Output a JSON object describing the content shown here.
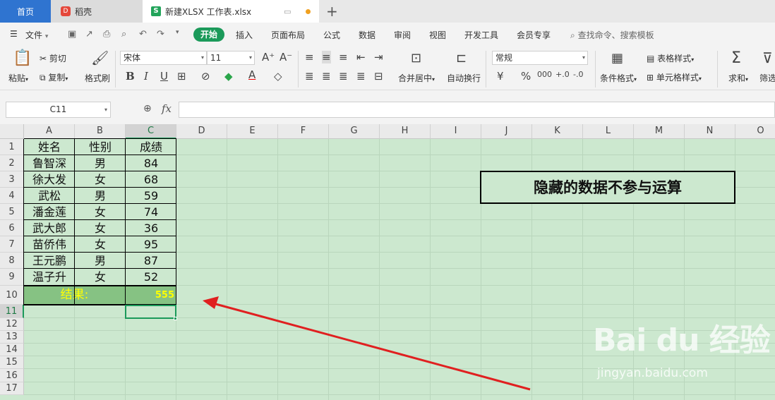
{
  "tabs": {
    "home": "首页",
    "daoke": "稻壳",
    "file": "新建XLSX 工作表.xlsx"
  },
  "menu": {
    "file": "文件",
    "items": [
      "开始",
      "插入",
      "页面布局",
      "公式",
      "数据",
      "审阅",
      "视图",
      "开发工具",
      "会员专享"
    ],
    "search": "查找命令、搜索模板"
  },
  "ribbon": {
    "paste": "粘贴",
    "cut": "剪切",
    "copy": "复制",
    "format_painter": "格式刷",
    "font_name": "宋体",
    "font_size": "11",
    "merge_center": "合并居中",
    "wrap_text": "自动换行",
    "number_format": "常规",
    "conditional_format": "条件格式",
    "table_style": "表格样式",
    "cell_style": "单元格样式",
    "sum": "求和",
    "filter": "筛选"
  },
  "formula_bar": {
    "cell_ref": "C11",
    "fx": "fx",
    "value": ""
  },
  "sheet": {
    "columns": [
      "A",
      "B",
      "C",
      "D",
      "E",
      "F",
      "G",
      "H",
      "I",
      "J",
      "K",
      "L",
      "M",
      "N",
      "O"
    ],
    "selected_column": "C",
    "rows": [
      "1",
      "2",
      "3",
      "4",
      "5",
      "6",
      "7",
      "8",
      "9",
      "10",
      "11",
      "12",
      "13",
      "14",
      "15",
      "16",
      "17"
    ],
    "selected_row": "11",
    "header": [
      "姓名",
      "性别",
      "成绩"
    ],
    "data": [
      [
        "鲁智深",
        "男",
        "84"
      ],
      [
        "徐大发",
        "女",
        "68"
      ],
      [
        "武松",
        "男",
        "59"
      ],
      [
        "潘金莲",
        "女",
        "74"
      ],
      [
        "武大郎",
        "女",
        "36"
      ],
      [
        "苗侨伟",
        "女",
        "95"
      ],
      [
        "王元鹏",
        "男",
        "87"
      ],
      [
        "温子升",
        "女",
        "52"
      ]
    ],
    "result_label": "结果:",
    "result_value": "555",
    "result_color": "#ffff00",
    "result_fill": "#86c283"
  },
  "annotation": {
    "note": "隐藏的数据不参与运算",
    "arrow_color": "#e02020"
  },
  "watermark": {
    "logo": "Bai du 经验",
    "url": "jingyan.baidu.com"
  },
  "colors": {
    "accent": "#1b9a5a",
    "sheet_bg": "#cce8cf",
    "home_tab": "#2f74d0"
  }
}
